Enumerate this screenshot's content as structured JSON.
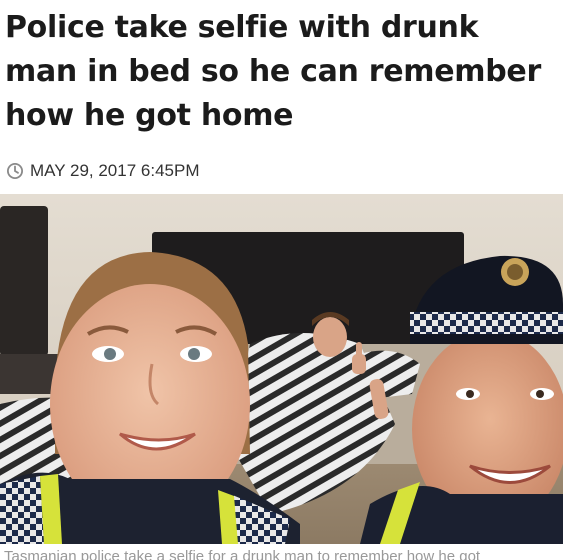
{
  "article": {
    "headline": "Police take selfie with drunk man in bed so he can remember how he got home",
    "date": "MAY 29, 2017 6:45PM",
    "caption": "Tasmanian police take a selfie for a drunk man to remember how he got"
  },
  "icons": {
    "clock": "clock-icon"
  }
}
